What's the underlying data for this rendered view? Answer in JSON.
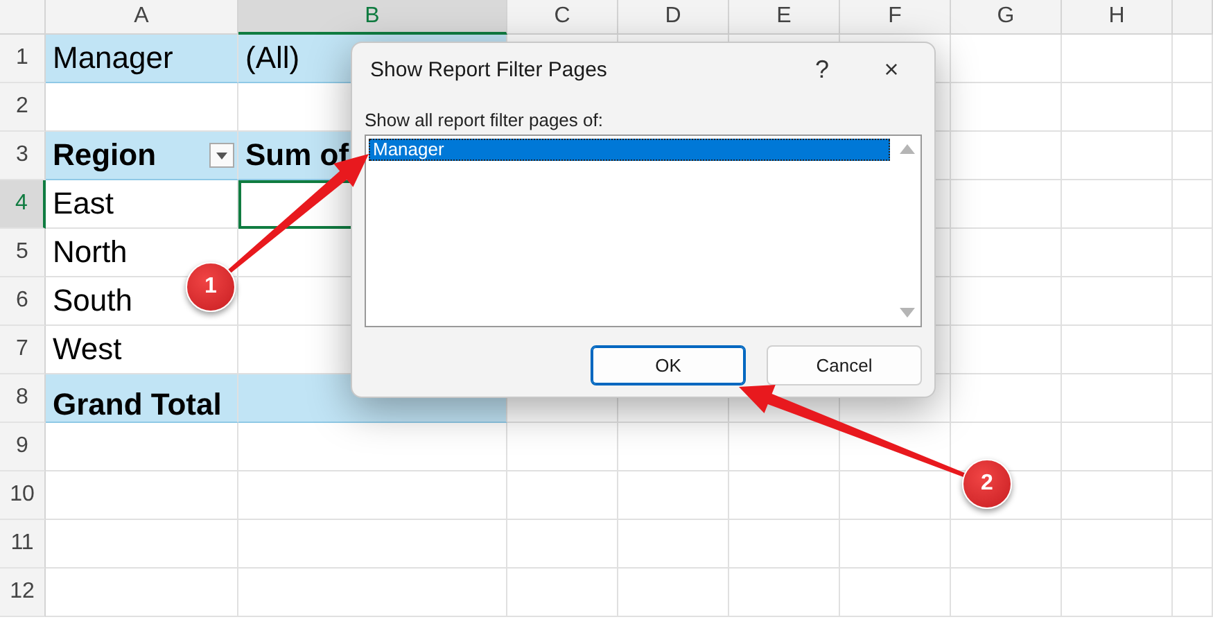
{
  "columns": [
    {
      "label": "A",
      "selected": false
    },
    {
      "label": "B",
      "selected": true
    },
    {
      "label": "C",
      "selected": false
    },
    {
      "label": "D",
      "selected": false
    },
    {
      "label": "E",
      "selected": false
    },
    {
      "label": "F",
      "selected": false
    },
    {
      "label": "G",
      "selected": false
    },
    {
      "label": "H",
      "selected": false
    }
  ],
  "rows": [
    {
      "number": "1",
      "selected": false,
      "cells": [
        {
          "kind": "filter",
          "text": "Manager",
          "selected": false
        },
        {
          "kind": "filter",
          "text": "(All)",
          "selected": false
        }
      ]
    },
    {
      "number": "2",
      "selected": false,
      "cells": []
    },
    {
      "number": "3",
      "selected": false,
      "cells": [
        {
          "kind": "header",
          "text": "Region",
          "selected": false,
          "dropdown": true
        },
        {
          "kind": "header",
          "text": "Sum of",
          "selected": false
        }
      ]
    },
    {
      "number": "4",
      "selected": true,
      "cells": [
        {
          "kind": "plain",
          "text": "East",
          "selected": false
        },
        {
          "kind": "plain",
          "selected": true
        }
      ]
    },
    {
      "number": "5",
      "selected": false,
      "cells": [
        {
          "kind": "plain",
          "text": "North",
          "selected": false
        }
      ]
    },
    {
      "number": "6",
      "selected": false,
      "cells": [
        {
          "kind": "plain",
          "text": "South",
          "selected": false
        }
      ]
    },
    {
      "number": "7",
      "selected": false,
      "cells": [
        {
          "kind": "plain",
          "text": "West",
          "selected": false
        }
      ]
    },
    {
      "number": "8",
      "selected": false,
      "cells": [
        {
          "kind": "total",
          "text": "Grand Total",
          "selected": false
        },
        {
          "kind": "total",
          "selected": false
        }
      ]
    },
    {
      "number": "9",
      "selected": false,
      "cells": []
    },
    {
      "number": "10",
      "selected": false,
      "cells": []
    },
    {
      "number": "11",
      "selected": false,
      "cells": []
    },
    {
      "number": "12",
      "selected": false,
      "cells": []
    }
  ],
  "dialog": {
    "title": "Show Report Filter Pages",
    "help": "?",
    "close": "×",
    "label": "Show all report filter pages of:",
    "items": [
      {
        "label": "Manager",
        "selected": true
      }
    ],
    "buttons": [
      {
        "label": "OK",
        "kind": "default"
      },
      {
        "label": "Cancel",
        "kind": "normal"
      }
    ]
  },
  "callouts": [
    {
      "number": "1"
    },
    {
      "number": "2"
    }
  ]
}
